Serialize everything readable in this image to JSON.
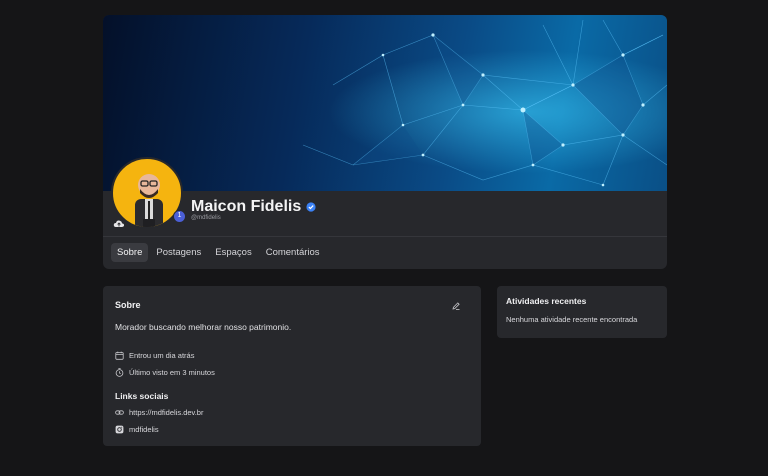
{
  "profile": {
    "name": "Maicon Fidelis",
    "handle": "@mdfidelis",
    "notification_count": "1"
  },
  "tabs": [
    {
      "label": "Sobre",
      "active": true
    },
    {
      "label": "Postagens",
      "active": false
    },
    {
      "label": "Espaços",
      "active": false
    },
    {
      "label": "Comentários",
      "active": false
    }
  ],
  "about": {
    "title": "Sobre",
    "bio": "Morador buscando melhorar nosso patrimonio.",
    "joined": "Entrou um dia atrás",
    "last_seen": "Último visto em 3 minutos",
    "links_title": "Links sociais",
    "links": [
      {
        "icon": "link-icon",
        "text": "https://mdfidelis.dev.br"
      },
      {
        "icon": "instagram-icon",
        "text": "mdfidelis"
      }
    ]
  },
  "activity": {
    "title": "Atividades recentes",
    "empty": "Nenhuma atividade recente encontrada"
  },
  "colors": {
    "background": "#151517",
    "card": "#27282c",
    "avatar_bg": "#f5b40f",
    "verified": "#3b82f6",
    "badge": "#4b5fd6"
  }
}
